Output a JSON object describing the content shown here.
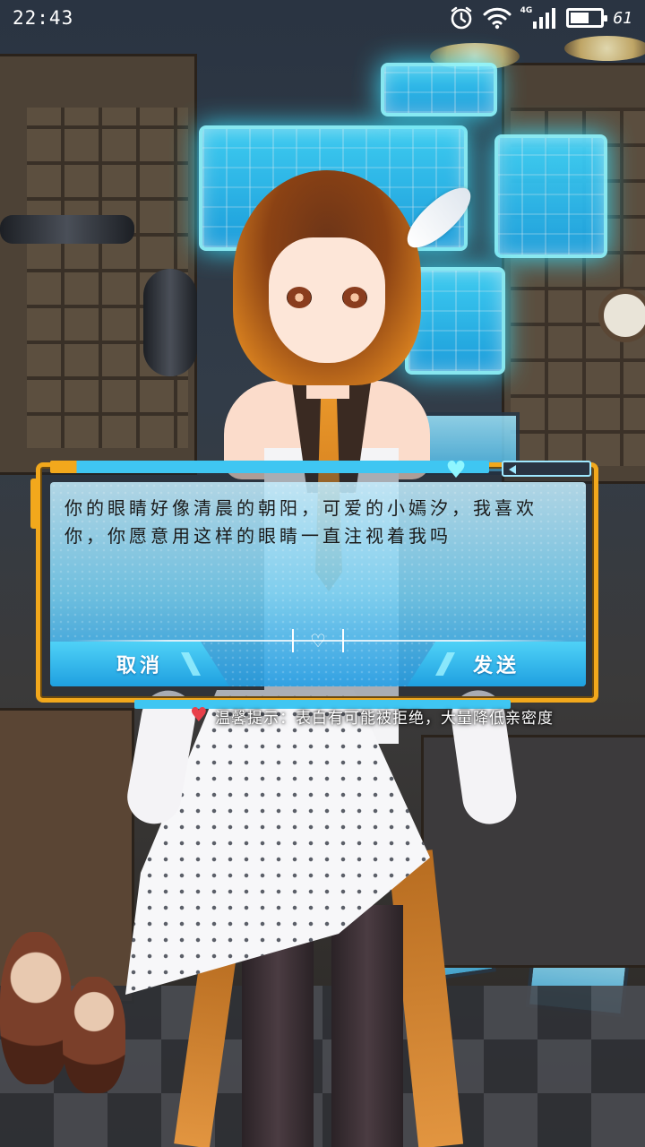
{
  "status_bar": {
    "time": "22:43",
    "network_label": "4G",
    "battery_level": "61",
    "battery_fraction": 0.61,
    "icons": [
      "alarm-icon",
      "wifi-icon",
      "signal-icon",
      "battery-icon"
    ]
  },
  "dialog": {
    "message": "你的眼睛好像清晨的朝阳，可爱的小嫣汐，我喜欢你，你愿意用这样的眼睛一直注视着我吗",
    "cancel_label": "取消",
    "send_label": "发送",
    "heart_icon": "heart-icon"
  },
  "tip": {
    "text": "温馨提示：表白有可能被拒绝，大量降低亲密度"
  },
  "colors": {
    "frame_orange": "#f2a81c",
    "panel_blue": "#3fc6f2",
    "tip_heart": "#e8404a"
  }
}
